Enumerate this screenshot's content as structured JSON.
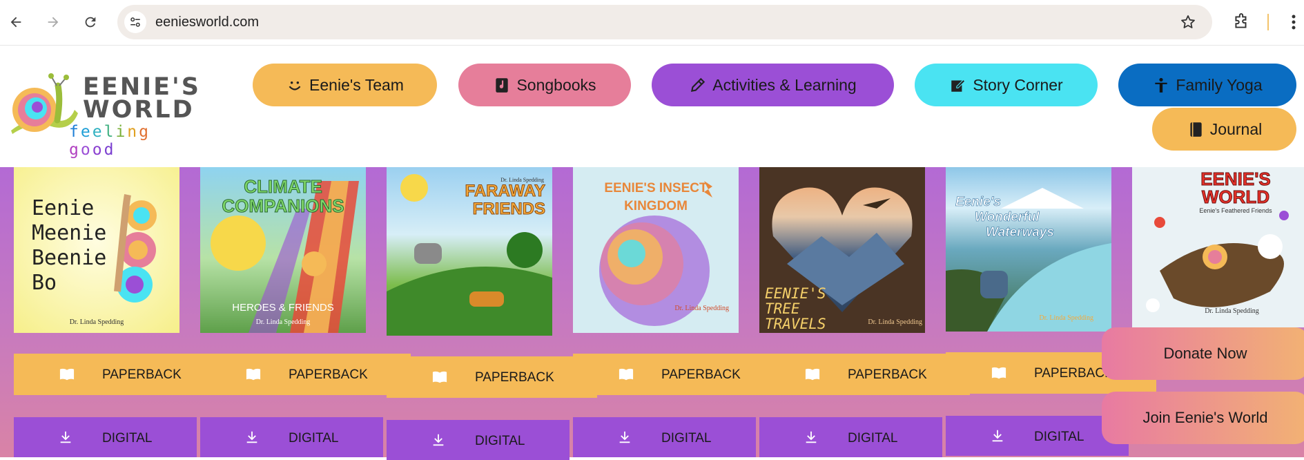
{
  "browser": {
    "url": "eeniesworld.com"
  },
  "logo": {
    "title_line1": "EENIE'S",
    "title_line2": "WORLD",
    "tagline": "feeling good"
  },
  "nav": [
    {
      "label": "Eenie's Team",
      "icon": "smile-icon",
      "color": "#f5ba57"
    },
    {
      "label": "Songbooks",
      "icon": "music-note-icon",
      "color": "#e67e9a"
    },
    {
      "label": "Activities & Learning",
      "icon": "pencil-icon",
      "color": "#9b4fd6"
    },
    {
      "label": "Story Corner",
      "icon": "edit-note-icon",
      "color": "#4ae3f2"
    },
    {
      "label": "Family Yoga",
      "icon": "person-icon",
      "color": "#0a6dc2"
    },
    {
      "label": "Journal",
      "icon": "book-icon",
      "color": "#f5ba57"
    }
  ],
  "books": [
    {
      "title_lines": [
        "Eenie",
        "Meenie",
        "Beenie",
        "Bo"
      ],
      "author": "Dr. Linda Spedding"
    },
    {
      "title_lines": [
        "CLIMATE",
        "COMPANIONS"
      ],
      "subtitle": "HEROES & FRIENDS",
      "author": "Dr. Linda Spedding"
    },
    {
      "title_lines": [
        "FARAWAY",
        "FRIENDS"
      ],
      "author": "Dr. Linda Spedding"
    },
    {
      "title_lines": [
        "EENIE'S INSECT",
        "KINGDOM"
      ],
      "author": "Dr. Linda Spedding"
    },
    {
      "title_lines": [
        "EENIE'S",
        "TREE",
        "TRAVELS"
      ],
      "author": "Dr. Linda Spedding"
    },
    {
      "title_lines": [
        "Eenie's",
        "Wonderful",
        "Waterways"
      ],
      "author": "Dr. Linda Spedding"
    },
    {
      "title_lines": [
        "EENIE'S",
        "WORLD"
      ],
      "subtitle": "Eenie's Feathered Friends",
      "author": "Dr. Linda Spedding"
    }
  ],
  "buttons": {
    "paperback": "PAPERBACK",
    "digital": "DIGITAL"
  },
  "cta": {
    "donate": "Donate Now",
    "join": "Join Eenie's World"
  }
}
